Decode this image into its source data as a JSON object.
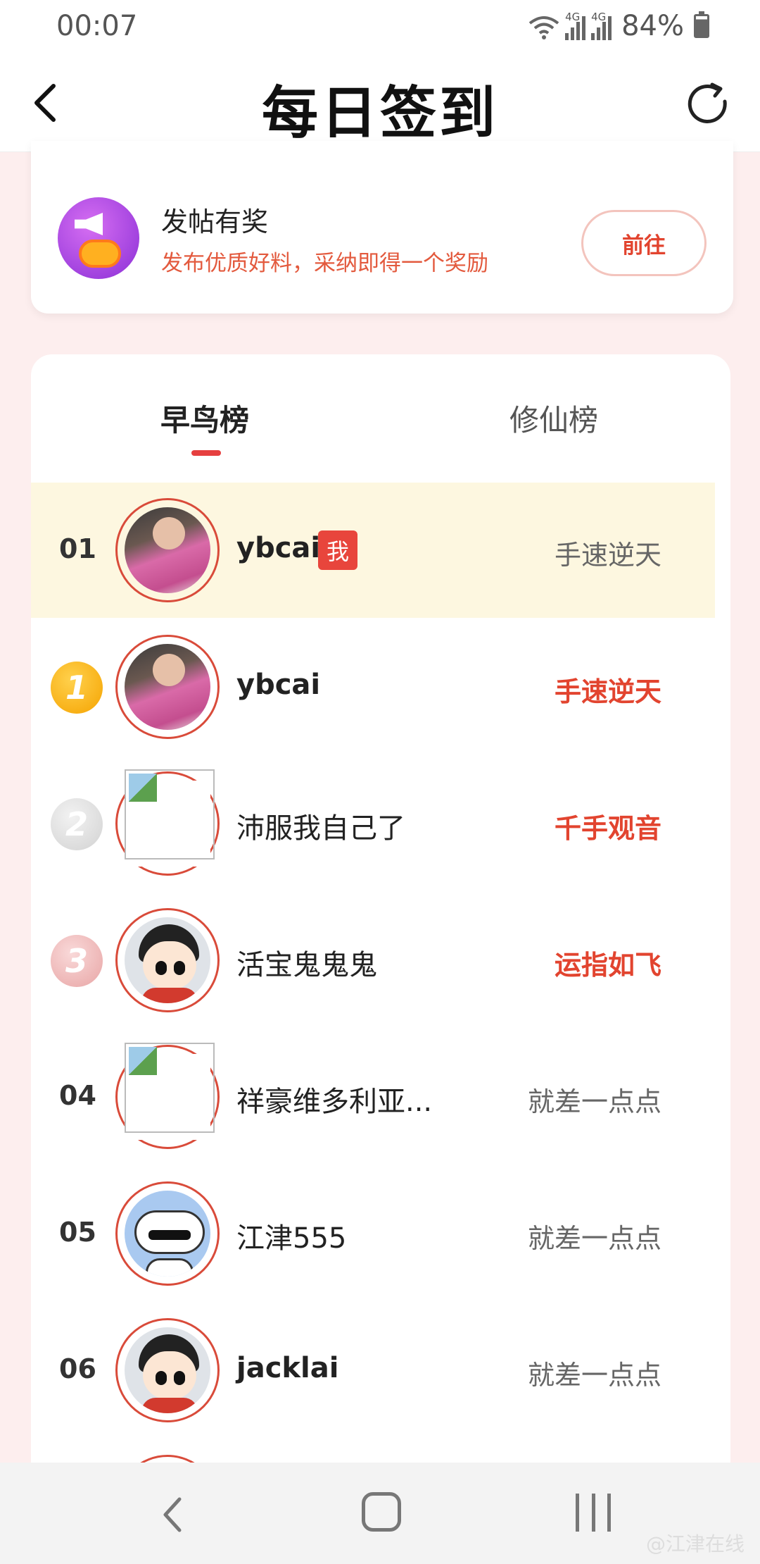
{
  "status_bar": {
    "time": "00:07",
    "battery": "84%",
    "network_label": "4G"
  },
  "header": {
    "title": "每日签到"
  },
  "post_card": {
    "title": "发帖有奖",
    "subtitle": "发布优质好料，采纳即得一个奖励",
    "button_label": "前往"
  },
  "ranking": {
    "tabs": [
      {
        "label": "早鸟榜",
        "active": true
      },
      {
        "label": "修仙榜",
        "active": false
      }
    ],
    "me_badge": "我",
    "rows": [
      {
        "rank": "01",
        "name": "ybcai",
        "label": "手速逆天"
      },
      {
        "rank": "1",
        "name": "ybcai",
        "label": "手速逆天"
      },
      {
        "rank": "2",
        "name": "沛服我自己了",
        "label": "千手观音"
      },
      {
        "rank": "3",
        "name": "活宝鬼鬼鬼",
        "label": "运指如飞"
      },
      {
        "rank": "04",
        "name": "祥豪维多利亚...",
        "label": "就差一点点"
      },
      {
        "rank": "05",
        "name": "江津555",
        "label": "就差一点点"
      },
      {
        "rank": "06",
        "name": "jacklai",
        "label": "就差一点点"
      }
    ]
  },
  "watermark": "@江津在线",
  "colors": {
    "accent": "#e2442f",
    "me_row_bg": "#fdf7e0",
    "page_bg": "#fdeeee"
  }
}
